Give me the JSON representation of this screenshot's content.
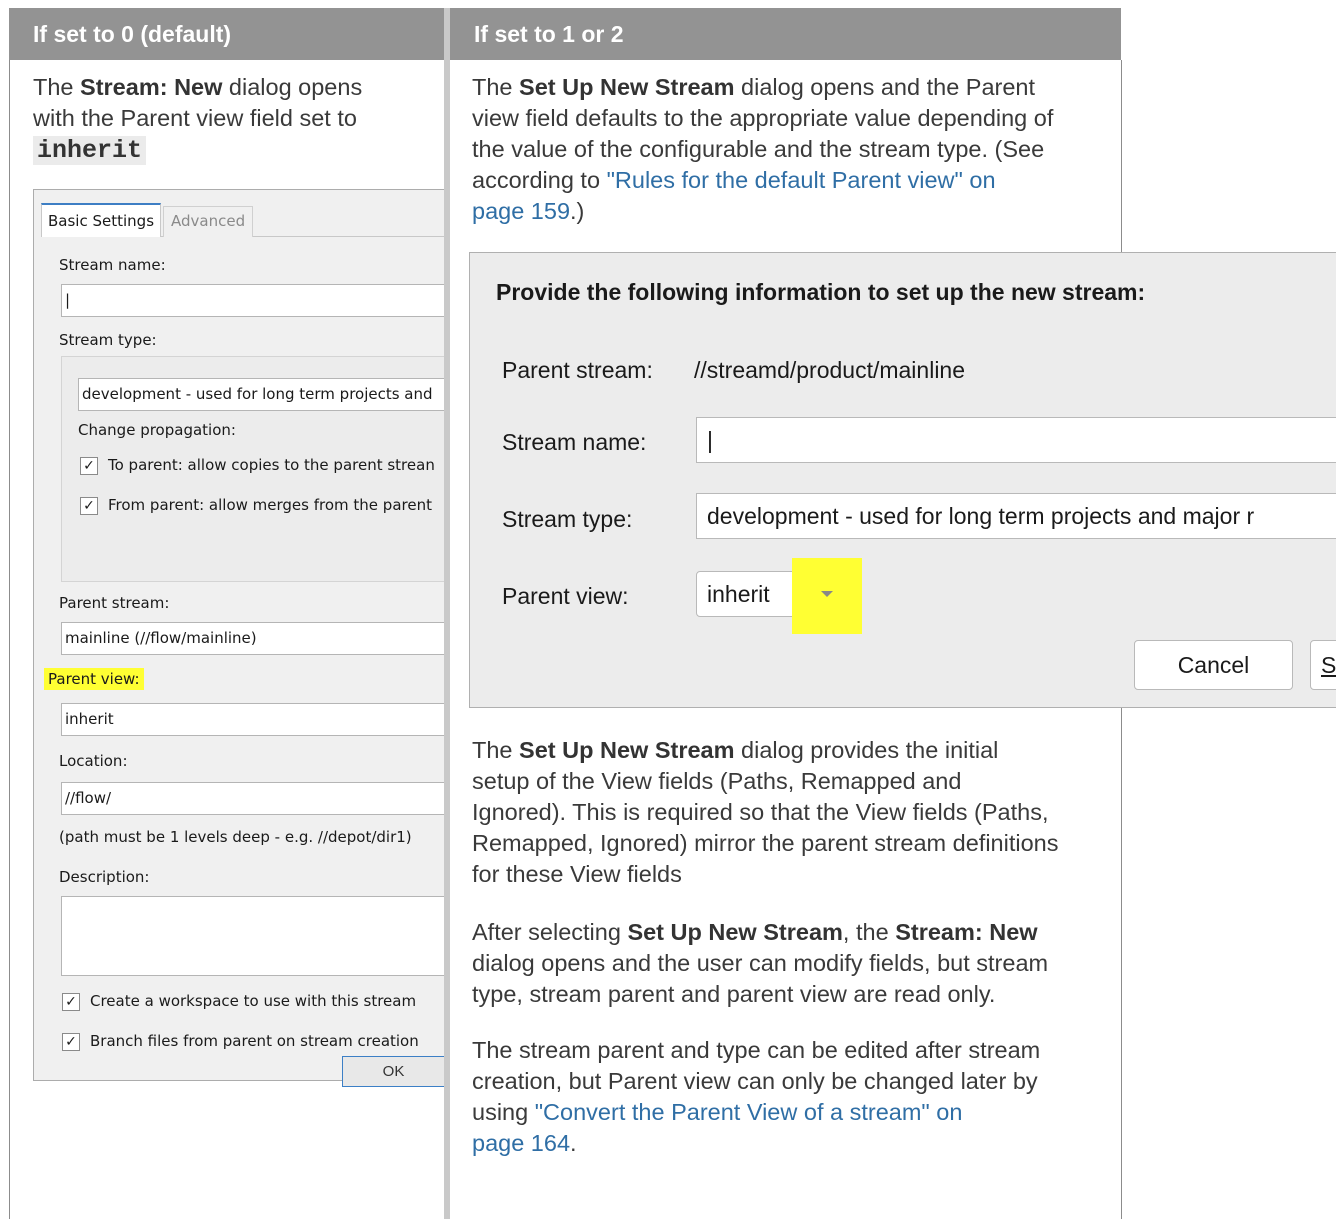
{
  "headers": {
    "left": "If set to 0 (default)",
    "right": "If set to 1 or 2"
  },
  "left_intro": {
    "p1": "The ",
    "b1": "Stream: New",
    "p2": " dialog opens",
    "line2": "with the Parent view field set to",
    "code": "inherit"
  },
  "right_intro": {
    "p1": "The ",
    "b1": "Set Up New Stream",
    "p2": " dialog opens and the Parent",
    "line2": "view field defaults to the appropriate value depending of",
    "line3": "the value of the configurable and the stream type. (See",
    "line4a": "according to ",
    "link1a": "\"Rules for the default Parent view\" on",
    "link1b": "page 159",
    "line5b": ".)"
  },
  "win_dialog": {
    "tabs": [
      "Basic Settings",
      "Advanced"
    ],
    "stream_name_label": "Stream name:",
    "stream_name_value": "|",
    "stream_type_label": "Stream type:",
    "stream_type_value": "development - used for long term projects and",
    "change_propagation": "Change propagation:",
    "to_parent": "To parent: allow copies to the parent strean",
    "from_parent": "From parent: allow merges from the parent",
    "check_mark": "✓",
    "parent_stream_label": "Parent stream:",
    "parent_stream_value": "mainline (//flow/mainline)",
    "parent_view_label": "Parent view:",
    "parent_view_value": "inherit",
    "location_label": "Location:",
    "location_value": "//flow/",
    "path_hint": "(path must be 1 levels deep - e.g. //depot/dir1)",
    "description_label": "Description:",
    "create_workspace": "Create a workspace to use with this stream",
    "branch_files": "Branch files from parent on stream creation",
    "ok": "OK"
  },
  "mac_dialog": {
    "title": "Provide the following information to set up the new stream:",
    "parent_stream_label": "Parent stream:",
    "parent_stream_value": "//streamd/product/mainline",
    "stream_name_label": "Stream name:",
    "stream_name_value": "|",
    "stream_type_label": "Stream type:",
    "stream_type_value": "development - used for long term projects and major r",
    "parent_view_label": "Parent view:",
    "parent_view_value": "inherit",
    "cancel": "Cancel",
    "setup": "Se"
  },
  "right_body": {
    "para1_a": "The ",
    "para1_b": "Set Up New Stream",
    "para1_c": " dialog provides the initial",
    "para1_l2": "setup of the View fields (Paths, Remapped and",
    "para1_l3": "Ignored). This is required so that the View fields (Paths,",
    "para1_l4": "Remapped, Ignored) mirror the parent stream definitions",
    "para1_l5": "for these View fields",
    "para2_a": "After selecting ",
    "para2_b": "Set Up New Stream",
    "para2_c": ", the ",
    "para2_d": "Stream: New",
    "para2_l2": "dialog opens and the user can modify fields, but stream",
    "para2_l3": "type, stream parent and parent view are read only.",
    "para3_l1": "The stream parent and type can be edited after stream",
    "para3_l2": "creation, but Parent view can only be changed later by",
    "para3_l3a": "using ",
    "para3_link_a": "\"Convert the Parent View of a stream\" on",
    "para3_link_b": "page 164",
    "para3_end": "."
  },
  "colors": {
    "header_bg": "#939393",
    "link": "#2f6ea5",
    "highlight": "#ffff33"
  }
}
